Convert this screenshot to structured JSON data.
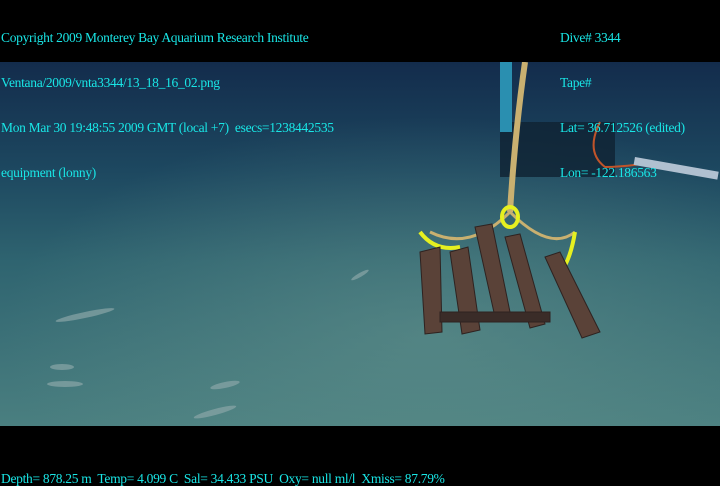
{
  "header_left": [
    "Copyright 2009 Monterey Bay Aquarium Research Institute",
    "Ventana/2009/vnta3344/13_18_16_02.png",
    "Mon Mar 30 19:48:55 2009 GMT (local +7)  esecs=1238442535",
    "equipment (lonny)"
  ],
  "header_right": [
    "Dive# 3344",
    "Tape#",
    "Lat= 36.712526 (edited)",
    "Lon= -122.186563"
  ],
  "footer": "Depth= 878.25 m  Temp= 4.099 C  Sal= 34.433 PSU  Oxy= null ml/l  Xmiss= 87.79%",
  "colors": {
    "overlay_text": "#19e6e6",
    "water": "#17385a",
    "seafloor": "#3f7278"
  }
}
